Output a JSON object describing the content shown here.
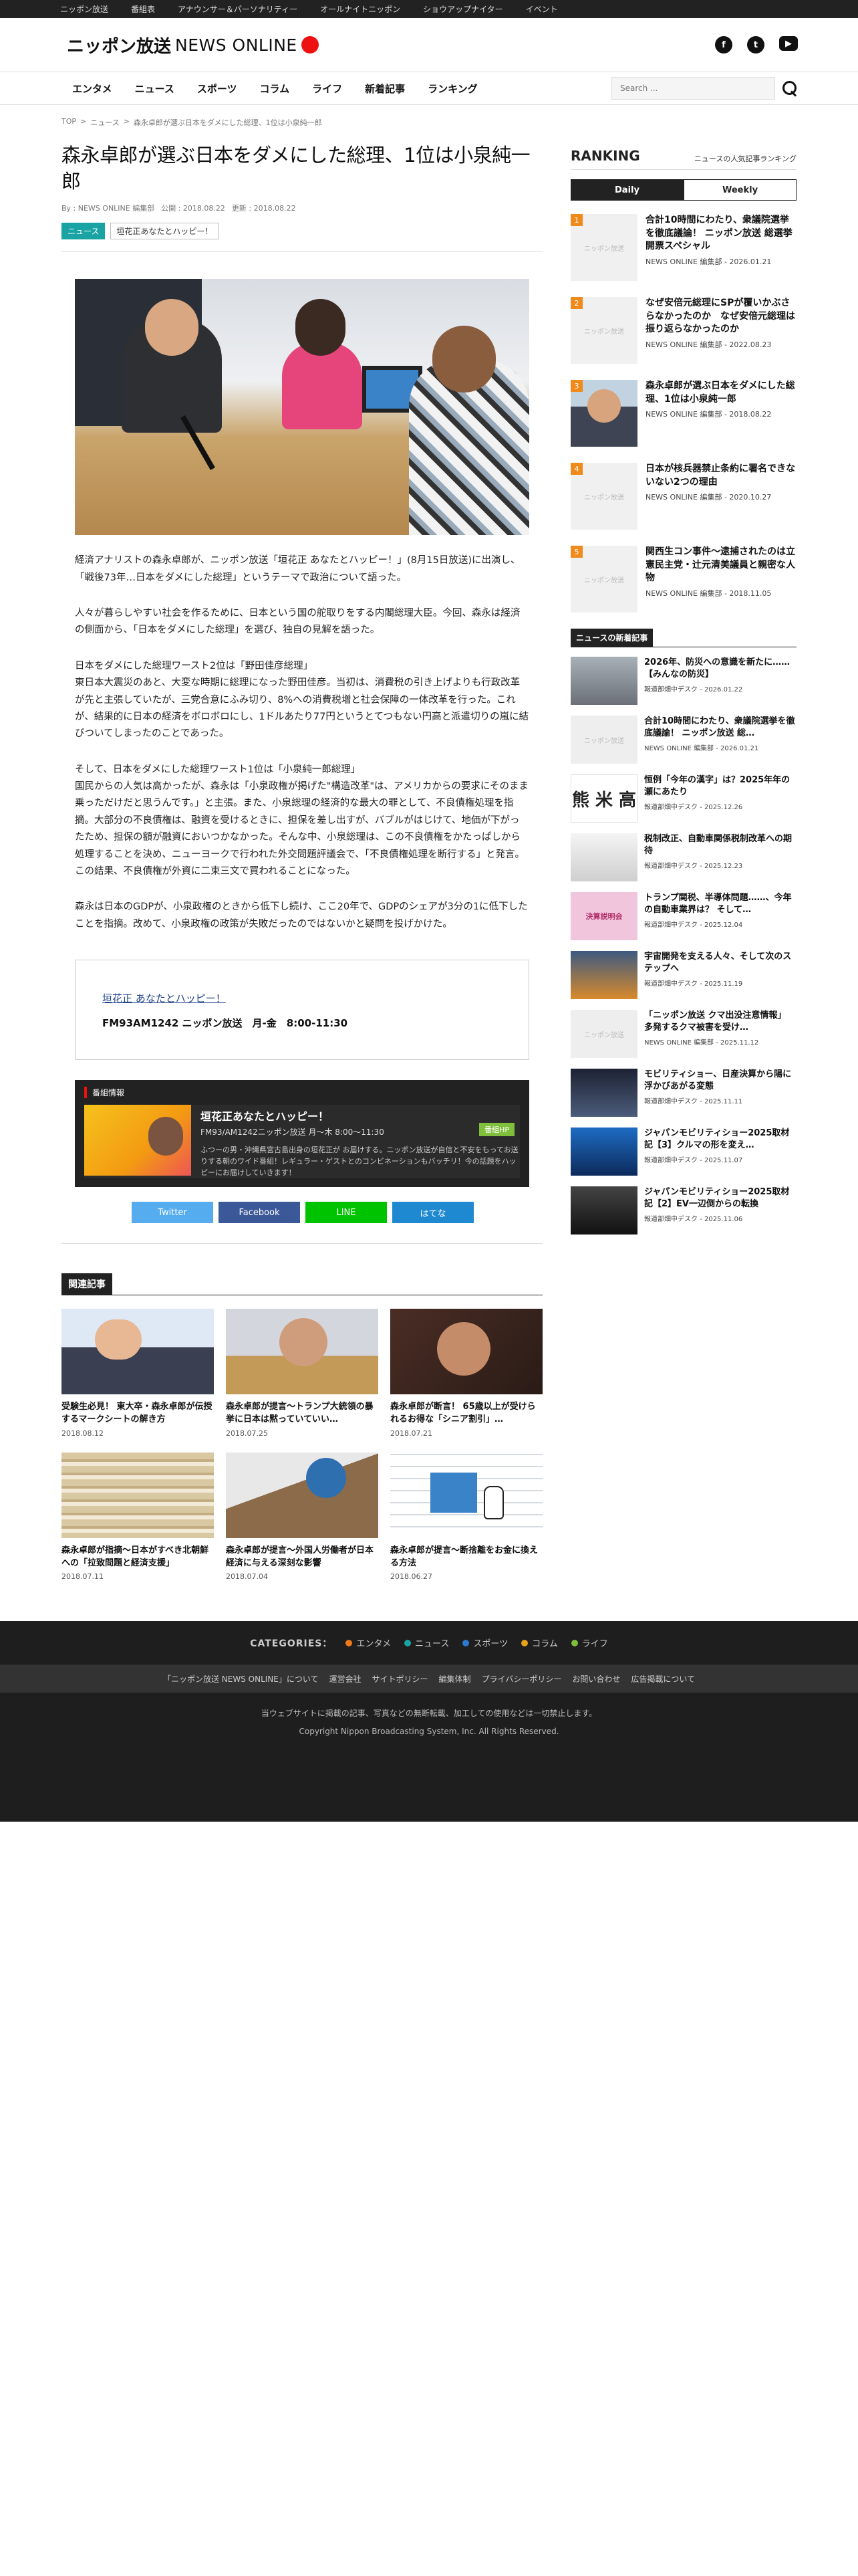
{
  "topbar": [
    "ニッポン放送",
    "番組表",
    "アナウンサー＆パーソナリティー",
    "オールナイトニッポン",
    "ショウアップナイター",
    "イベント"
  ],
  "logo": {
    "jp": "ニッポン放送",
    "en": "NEWS ONLINE"
  },
  "social": {
    "facebook": "f",
    "twitter": "t",
    "youtube": "▶"
  },
  "nav": [
    "エンタメ",
    "ニュース",
    "スポーツ",
    "コラム",
    "ライフ",
    "新着記事",
    "ランキング"
  ],
  "search": {
    "placeholder": "Search ..."
  },
  "breadcrumb": [
    "TOP",
    ">",
    "ニュース",
    ">",
    "森永卓郎が選ぶ日本をダメにした総理、1位は小泉純一郎"
  ],
  "article": {
    "title": "森永卓郎が選ぶ日本をダメにした総理、1位は小泉純一郎",
    "by": "By : NEWS ONLINE 編集部",
    "published": "公開 : 2018.08.22",
    "updated": "更新 : 2018.08.22",
    "tags": [
      "ニュース",
      "垣花正あなたとハッピー！"
    ],
    "paragraphs": [
      "経済アナリストの森永卓郎が、ニッポン放送「垣花正 あなたとハッピー！」(8月15日放送)に出演し、「戦後73年…日本をダメにした総理」というテーマで政治について語った。",
      "人々が暮らしやすい社会を作るために、日本という国の舵取りをする内閣総理大臣。今回、森永は経済の側面から、「日本をダメにした総理」を選び、独自の見解を語った。",
      "日本をダメにした総理ワースト2位は「野田佳彦総理」\n東日本大震災のあと、大変な時期に総理になった野田佳彦。当初は、消費税の引き上げよりも行政改革が先と主張していたが、三党合意にふみ切り、8%への消費税増と社会保障の一体改革を行った。これが、結果的に日本の経済をボロボロにし、1ドルあたり77円というとてつもない円高と派遣切りの嵐に結びついてしまったのことであった。",
      "そして、日本をダメにした総理ワースト1位は「小泉純一郎総理」\n国民からの人気は高かったが、森永は「小泉政権が掲げた\"構造改革\"は、アメリカからの要求にそのまま乗っただけだと思うんです。」と主張。また、小泉総理の経済的な最大の罪として、不良債権処理を指摘。大部分の不良債権は、融資を受けるときに、担保を差し出すが、バブルがはじけて、地価が下がったため、担保の額が融資においつかなかった。そんな中、小泉総理は、この不良債権をかたっぱしから処理することを決め、ニューヨークで行われた外交問題評議会で、「不良債権処理を断行する」と発言。この結果、不良債権が外資に二束三文で買われることになった。",
      "森永は日本のGDPが、小泉政権のときから低下し続け、ここ20年で、GDPのシェアが3分の1に低下したことを指摘。改めて、小泉政権の政策が失敗だったのではないかと疑問を投げかけた。"
    ],
    "info_link": "垣花正 あなたとハッピー！",
    "info_freq": "FM93AM1242 ニッポン放送　月-金　8:00-11:30",
    "program": {
      "heading": "番組情報",
      "name": "垣花正あなたとハッピー！",
      "time": "FM93/AM1242ニッポン放送 月～木 8:00～11:30",
      "desc": "ふつーの男・沖縄県宮古島出身の垣花正が お届けする。ニッポン放送が自信と不安をもってお送りする朝のワイド番組！レギュラー・ゲストとのコンビネーションもバッチリ！今の話題をハッピーにお届けしていきます！",
      "home": "番組HP"
    },
    "share": [
      "Twitter",
      "Facebook",
      "LINE",
      "はてな"
    ]
  },
  "related": {
    "heading": "関連記事",
    "items": [
      {
        "title": "受験生必見！ 東大卒・森永卓郎が伝授するマークシートの解き方",
        "date": "2018.08.12"
      },
      {
        "title": "森永卓郎が提言～トランプ大統領の暴挙に日本は黙っていていい…",
        "date": "2018.07.25"
      },
      {
        "title": "森永卓郎が断言！ 65歳以上が受けられるお得な「シニア割引」…",
        "date": "2018.07.21"
      },
      {
        "title": "森永卓郎が指摘～日本がすべき北朝鮮への「拉致問題と経済支援」",
        "date": "2018.07.11"
      },
      {
        "title": "森永卓郎が提言～外国人労働者が日本経済に与える深刻な影響",
        "date": "2018.07.04"
      },
      {
        "title": "森永卓郎が提言～断捨離をお金に換える方法",
        "date": "2018.06.27"
      }
    ]
  },
  "ranking": {
    "title": "RANKING",
    "subtitle": "ニュースの人気記事ランキング",
    "tabs": [
      "Daily",
      "Weekly"
    ],
    "placeholder": "ニッポン放送",
    "items": [
      {
        "num": "1",
        "title": "合計10時間にわたり、衆議院選挙を徹底議論！ ニッポン放送 総選挙開票スペシャル",
        "meta": "NEWS ONLINE 編集部 - 2026.01.21"
      },
      {
        "num": "2",
        "title": "なぜ安倍元総理にSPが覆いかぶさらなかったのか　なぜ安倍元総理は振り返らなかったのか",
        "meta": "NEWS ONLINE 編集部 - 2022.08.23"
      },
      {
        "num": "3",
        "title": "森永卓郎が選ぶ日本をダメにした総理、1位は小泉純一郎",
        "meta": "NEWS ONLINE 編集部 - 2018.08.22"
      },
      {
        "num": "4",
        "title": "日本が核兵器禁止条約に署名できないない2つの理由",
        "meta": "NEWS ONLINE 編集部 - 2020.10.27"
      },
      {
        "num": "5",
        "title": "関西生コン事件～逮捕されたのは立憲民主党・辻元清美議員と親密な人物",
        "meta": "NEWS ONLINE 編集部 - 2018.11.05"
      }
    ]
  },
  "news": {
    "heading": "ニュースの新着記事",
    "items": [
      {
        "title": "2026年、防災への意識を新たに……【みんなの防災】",
        "meta": "報道部畑中デスク - 2026.01.22",
        "thumb": ""
      },
      {
        "title": "合計10時間にわたり、衆議院選挙を徹底議論！ ニッポン放送 総…",
        "meta": "NEWS ONLINE 編集部 - 2026.01.21",
        "thumb": "ニッポン放送"
      },
      {
        "title": "恒例「今年の漢字」は？2025年年の瀬にあたり",
        "meta": "報道部畑中デスク - 2025.12.26",
        "thumb": "熊 米 高"
      },
      {
        "title": "税制改正、自動車関係税制改革への期待",
        "meta": "報道部畑中デスク - 2025.12.23",
        "thumb": ""
      },
      {
        "title": "トランプ関税、半導体問題……、今年の自動車業界は？ そして…",
        "meta": "報道部畑中デスク - 2025.12.04",
        "thumb": "決算説明会"
      },
      {
        "title": "宇宙開発を支える人々、そして次のステップへ",
        "meta": "報道部畑中デスク - 2025.11.19",
        "thumb": ""
      },
      {
        "title": "「ニッポン放送 クマ出没注意情報」 多発するクマ被害を受け…",
        "meta": "NEWS ONLINE 編集部 - 2025.11.12",
        "thumb": "ニッポン放送"
      },
      {
        "title": "モビリティショー、日産決算から陽に浮かびあがる変態",
        "meta": "報道部畑中デスク - 2025.11.11",
        "thumb": ""
      },
      {
        "title": "ジャパンモビリティショー2025取材記【3】クルマの形を変え…",
        "meta": "報道部畑中デスク - 2025.11.07",
        "thumb": ""
      },
      {
        "title": "ジャパンモビリティショー2025取材記【2】EV一辺倒からの転換",
        "meta": "報道部畑中デスク - 2025.11.06",
        "thumb": ""
      }
    ]
  },
  "footer": {
    "categories_label": "CATEGORIES：",
    "categories": [
      {
        "label": "エンタメ",
        "color": "#f07a1a"
      },
      {
        "label": "ニュース",
        "color": "#1aa3a3"
      },
      {
        "label": "スポーツ",
        "color": "#2a7bd0"
      },
      {
        "label": "コラム",
        "color": "#e8a21a"
      },
      {
        "label": "ライフ",
        "color": "#7dbf3b"
      }
    ],
    "links": [
      "「ニッポン放送 NEWS ONLINE」について",
      "運営会社",
      "サイトポリシー",
      "編集体制",
      "プライバシーポリシー",
      "お問い合わせ",
      "広告掲載について"
    ],
    "note": "当ウェブサイトに掲載の記事、写真などの無断転載、加工しての使用などは一切禁止します。",
    "copyright": "Copyright Nippon Broadcasting System, Inc. All Rights Reserved."
  }
}
